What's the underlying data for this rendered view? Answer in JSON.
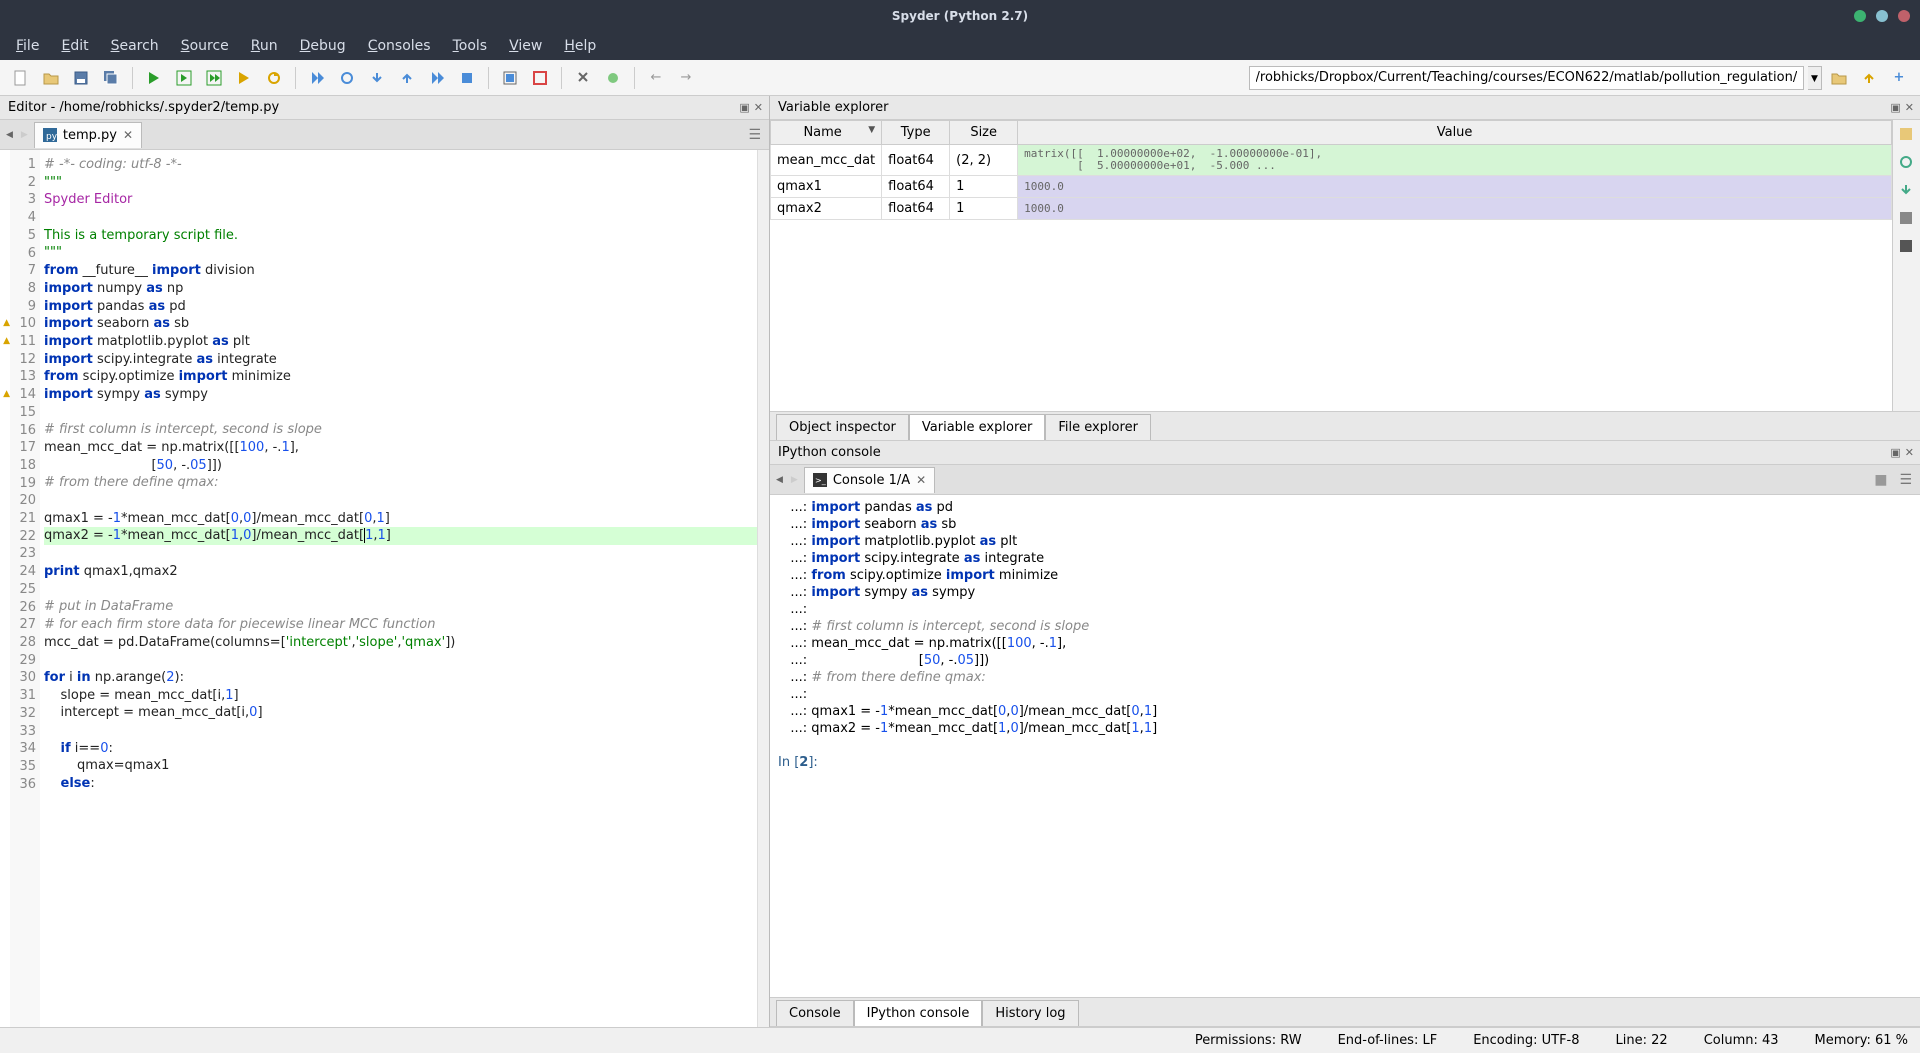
{
  "title": "Spyder (Python 2.7)",
  "menu": [
    "File",
    "Edit",
    "Search",
    "Source",
    "Run",
    "Debug",
    "Consoles",
    "Tools",
    "View",
    "Help"
  ],
  "path_input": "/robhicks/Dropbox/Current/Teaching/courses/ECON622/matlab/pollution_regulation/EPA_Data/prepackaged_data",
  "editor_panel_title": "Editor - /home/robhicks/.spyder2/temp.py",
  "file_tab": "temp.py",
  "varexp": {
    "title": "Variable explorer",
    "cols": [
      "Name",
      "Type",
      "Size",
      "Value"
    ],
    "rows": [
      {
        "name": "mean_mcc_dat",
        "type": "float64",
        "size": "(2, 2)",
        "value": "matrix([[  1.00000000e+02,  -1.00000000e-01],\n        [  5.00000000e+01,  -5.000 ...",
        "cls": "var-row-green"
      },
      {
        "name": "qmax1",
        "type": "float64",
        "size": "1",
        "value": "1000.0",
        "cls": "var-row-purple"
      },
      {
        "name": "qmax2",
        "type": "float64",
        "size": "1",
        "value": "1000.0",
        "cls": "var-row-purple"
      }
    ],
    "tabs": [
      "Object inspector",
      "Variable explorer",
      "File explorer"
    ]
  },
  "ipython": {
    "title": "IPython console",
    "tab": "Console 1/A",
    "tabs": [
      "Console",
      "IPython console",
      "History log"
    ],
    "prompt_in": "In [2]:"
  },
  "status": {
    "perm": "Permissions: RW",
    "eol": "End-of-lines: LF",
    "enc": "Encoding: UTF-8",
    "line": "Line: 22",
    "col": "Column: 43",
    "mem": "Memory: 61 %"
  },
  "code_lines": [
    {
      "n": 1,
      "h": "<span class=\"cm\"># -*- coding: utf-8 -*-</span>"
    },
    {
      "n": 2,
      "h": "<span class=\"st\">\"\"\"</span>"
    },
    {
      "n": 3,
      "h": "<span class=\"cls\">Spyder Editor</span>"
    },
    {
      "n": 4,
      "h": ""
    },
    {
      "n": 5,
      "h": "<span class=\"st\">This is a temporary script file.</span>"
    },
    {
      "n": 6,
      "h": "<span class=\"st\">\"\"\"</span>"
    },
    {
      "n": 7,
      "h": "<span class=\"kw\">from</span> __future__ <span class=\"kw\">import</span> division"
    },
    {
      "n": 8,
      "h": "<span class=\"kw\">import</span> numpy <span class=\"kw\">as</span> np"
    },
    {
      "n": 9,
      "h": "<span class=\"kw\">import</span> pandas <span class=\"kw\">as</span> pd"
    },
    {
      "n": 10,
      "warn": true,
      "h": "<span class=\"kw\">import</span> seaborn <span class=\"kw\">as</span> sb"
    },
    {
      "n": 11,
      "warn": true,
      "h": "<span class=\"kw\">import</span> matplotlib.pyplot <span class=\"kw\">as</span> plt"
    },
    {
      "n": 12,
      "h": "<span class=\"kw\">import</span> scipy.integrate <span class=\"kw\">as</span> integrate"
    },
    {
      "n": 13,
      "h": "<span class=\"kw\">from</span> scipy.optimize <span class=\"kw\">import</span> minimize"
    },
    {
      "n": 14,
      "warn": true,
      "h": "<span class=\"kw\">import</span> sympy <span class=\"kw\">as</span> sympy"
    },
    {
      "n": 15,
      "h": ""
    },
    {
      "n": 16,
      "h": "<span class=\"cm\"># first column is intercept, second is slope</span>"
    },
    {
      "n": 17,
      "h": "mean_mcc_dat = np.matrix([[<span class=\"nm\">100</span>, -.<span class=\"nm\">1</span>],"
    },
    {
      "n": 18,
      "h": "                          [<span class=\"nm\">50</span>, -.<span class=\"nm\">05</span>]])"
    },
    {
      "n": 19,
      "h": "<span class=\"cm\"># from there define qmax:</span>"
    },
    {
      "n": 20,
      "h": ""
    },
    {
      "n": 21,
      "h": "qmax1 = -<span class=\"nm\">1</span>*mean_mcc_dat[<span class=\"nm\">0</span>,<span class=\"nm\">0</span>]/mean_mcc_dat[<span class=\"nm\">0</span>,<span class=\"nm\">1</span>]"
    },
    {
      "n": 22,
      "cur": true,
      "h": "qmax2 = -<span class=\"nm\">1</span>*mean_mcc_dat[<span class=\"nm\">1</span>,<span class=\"nm\">0</span>]/mean_mcc_dat[<span style=\"border-left:1px solid #000\"></span><span class=\"nm\">1</span>,<span class=\"nm\">1</span>]"
    },
    {
      "n": 23,
      "h": ""
    },
    {
      "n": 24,
      "h": "<span class=\"kw\">print</span> qmax1,qmax2"
    },
    {
      "n": 25,
      "h": ""
    },
    {
      "n": 26,
      "h": "<span class=\"cm\"># put in DataFrame</span>"
    },
    {
      "n": 27,
      "h": "<span class=\"cm\"># for each firm store data for piecewise linear MCC function</span>"
    },
    {
      "n": 28,
      "h": "mcc_dat = pd.DataFrame(columns=[<span class=\"st\">'intercept'</span>,<span class=\"st\">'slope'</span>,<span class=\"st\">'qmax'</span>])"
    },
    {
      "n": 29,
      "h": ""
    },
    {
      "n": 30,
      "h": "<span class=\"kw\">for</span> i <span class=\"kw\">in</span> np.arange(<span class=\"nm\">2</span>):"
    },
    {
      "n": 31,
      "h": "    slope = mean_mcc_dat[i,<span class=\"nm\">1</span>]"
    },
    {
      "n": 32,
      "h": "    intercept = mean_mcc_dat[i,<span class=\"nm\">0</span>]"
    },
    {
      "n": 33,
      "h": ""
    },
    {
      "n": 34,
      "h": "    <span class=\"kw\">if</span> i==<span class=\"nm\">0</span>:"
    },
    {
      "n": 35,
      "h": "        qmax=qmax1"
    },
    {
      "n": 36,
      "h": "    <span class=\"kw\">else</span>:"
    }
  ],
  "console_lines": [
    {
      "h": "   ...: <span class=\"kw\">import</span> pandas <span class=\"kw\">as</span> pd"
    },
    {
      "h": "   ...: <span class=\"kw\">import</span> seaborn <span class=\"kw\">as</span> sb"
    },
    {
      "h": "   ...: <span class=\"kw\">import</span> matplotlib.pyplot <span class=\"kw\">as</span> plt"
    },
    {
      "h": "   ...: <span class=\"kw\">import</span> scipy.integrate <span class=\"kw\">as</span> integrate"
    },
    {
      "h": "   ...: <span class=\"kw\">from</span> scipy.optimize <span class=\"kw\">import</span> minimize"
    },
    {
      "h": "   ...: <span class=\"kw\">import</span> sympy <span class=\"kw\">as</span> sympy"
    },
    {
      "h": "   ...: "
    },
    {
      "h": "   ...: <span class=\"cm\"># first column is intercept, second is slope</span>"
    },
    {
      "h": "   ...: mean_mcc_dat = np.matrix([[<span class=\"nm\">100</span>, -.<span class=\"nm\">1</span>],"
    },
    {
      "h": "   ...:                           [<span class=\"nm\">50</span>, -.<span class=\"nm\">05</span>]])"
    },
    {
      "h": "   ...: <span class=\"cm\"># from there define qmax:</span>"
    },
    {
      "h": "   ...: "
    },
    {
      "h": "   ...: qmax1 = -<span class=\"nm\">1</span>*mean_mcc_dat[<span class=\"nm\">0</span>,<span class=\"nm\">0</span>]/mean_mcc_dat[<span class=\"nm\">0</span>,<span class=\"nm\">1</span>]"
    },
    {
      "h": "   ...: qmax2 = -<span class=\"nm\">1</span>*mean_mcc_dat[<span class=\"nm\">1</span>,<span class=\"nm\">0</span>]/mean_mcc_dat[<span class=\"nm\">1</span>,<span class=\"nm\">1</span>]"
    },
    {
      "h": ""
    },
    {
      "h": "<span style=\"color:#2c5d8c\">In [</span><span style=\"color:#2c5d8c;font-weight:600\">2</span><span style=\"color:#2c5d8c\">]:</span> "
    }
  ]
}
